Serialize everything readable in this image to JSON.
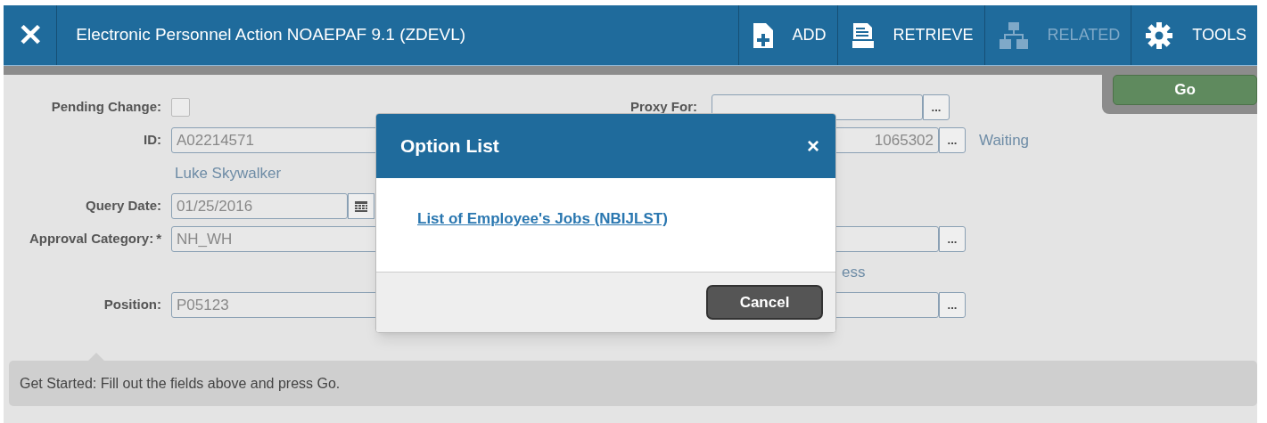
{
  "window": {
    "title": "Electronic Personnel Action NOAEPAF 9.1 (ZDEVL)",
    "close": "✕"
  },
  "toolbar": [
    {
      "kind": "add",
      "label": "ADD",
      "disabled": false
    },
    {
      "kind": "retrieve",
      "label": "RETRIEVE",
      "disabled": false
    },
    {
      "kind": "related",
      "label": "RELATED",
      "disabled": true
    },
    {
      "kind": "tools",
      "label": "TOOLS",
      "disabled": false
    }
  ],
  "go_button": "Go",
  "form": {
    "pending_change": {
      "label": "Pending Change:",
      "checked": false
    },
    "id": {
      "label": "ID:",
      "value": "A02214571",
      "name": "Luke Skywalker"
    },
    "query_date": {
      "label": "Query Date:",
      "value": "01/25/2016"
    },
    "approval_category": {
      "label": "Approval Category:",
      "required": "*",
      "value": "NH_WH"
    },
    "position": {
      "label": "Position:",
      "value": "P05123"
    },
    "proxy_for": {
      "label": "Proxy For:",
      "button": "..."
    },
    "transaction": {
      "value": "1065302",
      "button": "...",
      "status": "Waiting"
    },
    "field_3": {
      "button": "..."
    },
    "field_3_description": "ess",
    "field_4": {
      "button": "..."
    }
  },
  "dialog": {
    "title": "Option List",
    "close": "×",
    "options": [
      "List of Employee's Jobs (NBIJLST)"
    ],
    "cancel": "Cancel"
  },
  "tip": "Get Started: Fill out the fields above and press Go."
}
